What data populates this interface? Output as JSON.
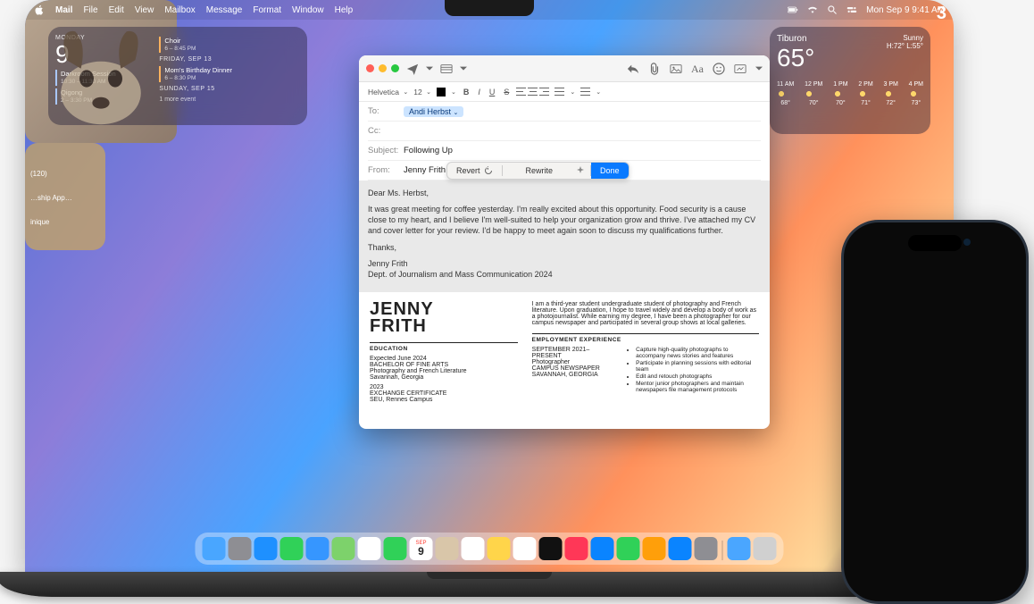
{
  "menubar": {
    "app": "Mail",
    "items": [
      "File",
      "Edit",
      "View",
      "Mailbox",
      "Message",
      "Format",
      "Window",
      "Help"
    ],
    "datetime": "Mon Sep 9  9:41 AM"
  },
  "calendar": {
    "day_label": "MONDAY",
    "day_number": "9",
    "events_col1": [
      {
        "title": "Darkroom Session",
        "time": "10:30 – 11:30 AM"
      },
      {
        "title": "Qigong",
        "time": "2 – 3:30 PM"
      }
    ],
    "events_col2": [
      {
        "title": "Choir",
        "time": "6 – 8:45 PM"
      },
      {
        "header": "FRIDAY, SEP 13"
      },
      {
        "title": "Mom's Birthday Dinner",
        "time": "6 – 8:30 PM"
      },
      {
        "header": "SUNDAY, SEP 15"
      }
    ],
    "more_label": "1 more event"
  },
  "weather": {
    "location": "Tiburon",
    "temp": "65°",
    "condition": "Sunny",
    "hilo": "H:72°  L:55°",
    "hours": [
      {
        "t": "11 AM",
        "v": "68°"
      },
      {
        "t": "12 PM",
        "v": "70°"
      },
      {
        "t": "1 PM",
        "v": "70°"
      },
      {
        "t": "2 PM",
        "v": "71°"
      },
      {
        "t": "3 PM",
        "v": "72°"
      },
      {
        "t": "4 PM",
        "v": "73°"
      }
    ]
  },
  "home": {
    "count": "3",
    "label": "(120)",
    "sub": "…ship App…",
    "sub2": "inique"
  },
  "mail": {
    "font_name": "Helvetica",
    "font_size": "12",
    "to_label": "To:",
    "to_value": "Andi Herbst",
    "cc_label": "Cc:",
    "cc_value": "",
    "subject_label": "Subject:",
    "subject_value": "Following Up",
    "from_label": "From:",
    "from_value": "Jenny Frith",
    "wt": {
      "revert": "Revert",
      "rewrite": "Rewrite",
      "done": "Done"
    },
    "body": {
      "p1": "Dear Ms. Herbst,",
      "p2": "It was great meeting for coffee yesterday. I'm really excited about this opportunity. Food security is a cause close to my heart, and I believe I'm well-suited to help your organization grow and thrive. I've attached my CV and cover letter for your review. I'd be happy to meet again soon to discuss my qualifications further.",
      "p3": "Thanks,",
      "p4": "Jenny Frith",
      "p5": "Dept. of Journalism and Mass Communication 2024"
    },
    "resume": {
      "name_line1": "JENNY",
      "name_line2": "FRITH",
      "intro": "I am a third-year student undergraduate student of photography and French literature. Upon graduation, I hope to travel widely and develop a body of work as a photojournalist. While earning my degree, I have been a photographer for our campus newspaper and participated in several group shows at local galleries.",
      "edu_h": "EDUCATION",
      "edu1": "Expected June 2024",
      "edu2": "BACHELOR OF FINE ARTS",
      "edu3": "Photography and French Literature",
      "edu4": "Savannah, Georgia",
      "edu5": "2023",
      "edu6": "EXCHANGE CERTIFICATE",
      "edu7": "SEU, Rennes Campus",
      "emp_h": "EMPLOYMENT EXPERIENCE",
      "emp1": "SEPTEMBER 2021–PRESENT",
      "emp2": "Photographer",
      "emp3": "CAMPUS NEWSPAPER",
      "emp4": "SAVANNAH, GEORGIA",
      "bullets": [
        "Capture high-quality photographs to accompany news stories and features",
        "Participate in planning sessions with editorial team",
        "Edit and retouch photographs",
        "Mentor junior photographers and maintain newspapers file management protocols"
      ]
    }
  },
  "dock": {
    "apps": [
      {
        "name": "finder",
        "bg": "#49a6ff"
      },
      {
        "name": "launchpad",
        "bg": "#8e8e93"
      },
      {
        "name": "safari",
        "bg": "#1e90ff"
      },
      {
        "name": "messages",
        "bg": "#30d158"
      },
      {
        "name": "mail",
        "bg": "#3696ff"
      },
      {
        "name": "maps",
        "bg": "#7dd26b"
      },
      {
        "name": "photos",
        "bg": "#fff"
      },
      {
        "name": "facetime",
        "bg": "#30d158"
      },
      {
        "name": "calendar",
        "bg": "#fff",
        "txt": "9",
        "txtc": "#222",
        "top": "SEP"
      },
      {
        "name": "contacts",
        "bg": "#d9c6a9"
      },
      {
        "name": "reminders",
        "bg": "#fff"
      },
      {
        "name": "notes",
        "bg": "#ffd54a"
      },
      {
        "name": "freeform",
        "bg": "#fff"
      },
      {
        "name": "tv",
        "bg": "#111"
      },
      {
        "name": "music",
        "bg": "#ff3757"
      },
      {
        "name": "keynote",
        "bg": "#0a84ff"
      },
      {
        "name": "numbers",
        "bg": "#30d158"
      },
      {
        "name": "pages",
        "bg": "#ff9f0a"
      },
      {
        "name": "appstore",
        "bg": "#0a84ff"
      },
      {
        "name": "settings",
        "bg": "#8e8e93"
      }
    ],
    "right": [
      {
        "name": "downloads",
        "bg": "#4aa6ff"
      },
      {
        "name": "trash",
        "bg": "#d0d0d0"
      }
    ]
  }
}
